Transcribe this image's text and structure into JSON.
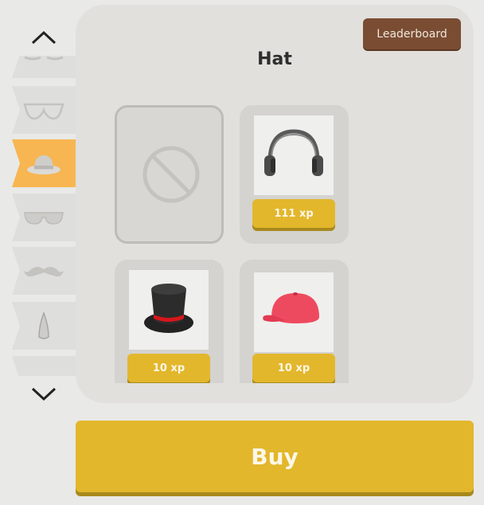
{
  "header": {
    "leaderboard_label": "Leaderboard"
  },
  "shop": {
    "category_title": "Hat"
  },
  "sidebar": {
    "categories": [
      {
        "icon": "glasses-icon",
        "active": false
      },
      {
        "icon": "goggles-icon",
        "active": false
      },
      {
        "icon": "hat-icon",
        "active": true
      },
      {
        "icon": "sunglasses-icon",
        "active": false
      },
      {
        "icon": "mustache-icon",
        "active": false
      },
      {
        "icon": "nose-icon",
        "active": false
      },
      {
        "icon": "unknown-icon",
        "active": false
      }
    ]
  },
  "items": [
    {
      "name": "none",
      "icon": "none-icon",
      "price": ""
    },
    {
      "name": "headphones",
      "icon": "headphones-icon",
      "price": "111 xp"
    },
    {
      "name": "top-hat",
      "icon": "top-hat-icon",
      "price": "10 xp"
    },
    {
      "name": "cap",
      "icon": "cap-icon",
      "price": "10 xp"
    }
  ],
  "footer": {
    "buy_label": "Buy"
  },
  "colors": {
    "accent_yellow": "#e3b72c",
    "active_category": "#f7b651",
    "leaderboard": "#7a4d33",
    "panel": "#e1e0dd"
  }
}
